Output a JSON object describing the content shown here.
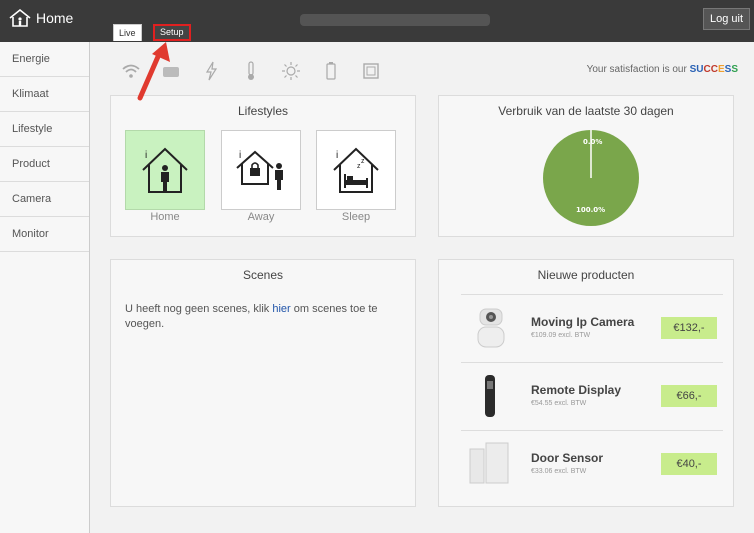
{
  "app": {
    "brand": "Home",
    "logout_label": "Log uit"
  },
  "tabs": [
    {
      "label": "Live"
    },
    {
      "label": "Setup"
    }
  ],
  "sidebar": {
    "items": [
      {
        "label": "Energie"
      },
      {
        "label": "Klimaat"
      },
      {
        "label": "Lifestyle"
      },
      {
        "label": "Product"
      },
      {
        "label": "Camera"
      },
      {
        "label": "Monitor"
      }
    ]
  },
  "toolbar": {
    "icons": [
      "wifi-icon",
      "device-icon",
      "energy-icon",
      "thermometer-icon",
      "sun-icon",
      "battery-icon",
      "frame-icon"
    ]
  },
  "satisfaction": {
    "text": "Your satisfaction is our",
    "word_letters": [
      "S",
      "U",
      "C",
      "C",
      "E",
      "S",
      "S"
    ],
    "word_colors": [
      "#2a62b5",
      "#2a62b5",
      "#c0392b",
      "#c0392b",
      "#f0a030",
      "#2a62b5",
      "#30a050"
    ]
  },
  "lifestyles": {
    "title": "Lifestyles",
    "items": [
      {
        "label": "Home",
        "active": true
      },
      {
        "label": "Away",
        "active": false
      },
      {
        "label": "Sleep",
        "active": false
      }
    ]
  },
  "verbruik": {
    "title": "Verbruik van de laatste 30 dagen",
    "pie_color": "#7aa64b",
    "slices": [
      {
        "label": "0.0%",
        "value": 0
      },
      {
        "label": "100.0%",
        "value": 100
      }
    ]
  },
  "scenes": {
    "title": "Scenes",
    "text_before": "U heeft nog geen scenes, klik ",
    "link": "hier",
    "text_after": " om scenes toe te voegen."
  },
  "nieuwe": {
    "title": "Nieuwe producten",
    "products": [
      {
        "name": "Moving Ip Camera",
        "sub": "€109.09 excl. BTW",
        "price": "€132,-"
      },
      {
        "name": "Remote Display",
        "sub": "€54.55 excl. BTW",
        "price": "€66,-"
      },
      {
        "name": "Door Sensor",
        "sub": "€33.06 excl. BTW",
        "price": "€40,-"
      }
    ]
  },
  "colors": {
    "topbar": "#3a3a3a",
    "accent_red": "#e02020",
    "price_bg": "#c8ec8c",
    "active_lifestyle": "#c9f2c0"
  }
}
